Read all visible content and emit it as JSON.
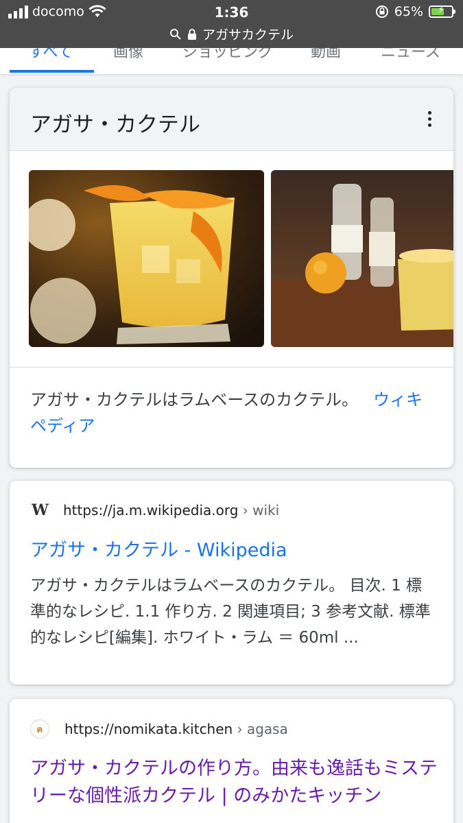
{
  "status_bar": {
    "carrier": "docomo",
    "time": "1:36",
    "battery_percent": "65%",
    "battery_level": 0.65
  },
  "url_bar": {
    "text": "アガサカクテル"
  },
  "tabs": [
    {
      "label": "すべて",
      "active": true
    },
    {
      "label": "画像"
    },
    {
      "label": "ショッピング"
    },
    {
      "label": "動画"
    },
    {
      "label": "ニュース"
    }
  ],
  "knowledge_panel": {
    "title": "アガサ・カクテル",
    "description": "アガサ・カクテルはラムベースのカクテル。",
    "source_link": "ウィキペディア",
    "images": [
      {
        "alt": "cocktail-glass-with-orange-peel"
      },
      {
        "alt": "bar-counter-with-rum-bottles"
      }
    ]
  },
  "results": [
    {
      "url": "https://ja.m.wikipedia.org",
      "breadcrumb": "› wiki",
      "title": "アガサ・カクテル - Wikipedia",
      "snippet": "アガサ・カクテルはラムベースのカクテル。 目次. 1 標準的なレシピ. 1.1 作り方. 2 関連項目; 3 参考文献. 標準的なレシピ[編集]. ホワイト・ラム ＝ 60ml ..."
    },
    {
      "url": "https://nomikata.kitchen",
      "breadcrumb": "› agasa",
      "title": "アガサ・カクテルの作り方。由来も逸話もミステリーな個性派カクテル | のみかたキッチン"
    }
  ],
  "colors": {
    "accent": "#1a73e8",
    "visited_link": "#681da8",
    "status_bar_bg": "#4b4b4b",
    "battery_fill": "#7bd44a"
  }
}
